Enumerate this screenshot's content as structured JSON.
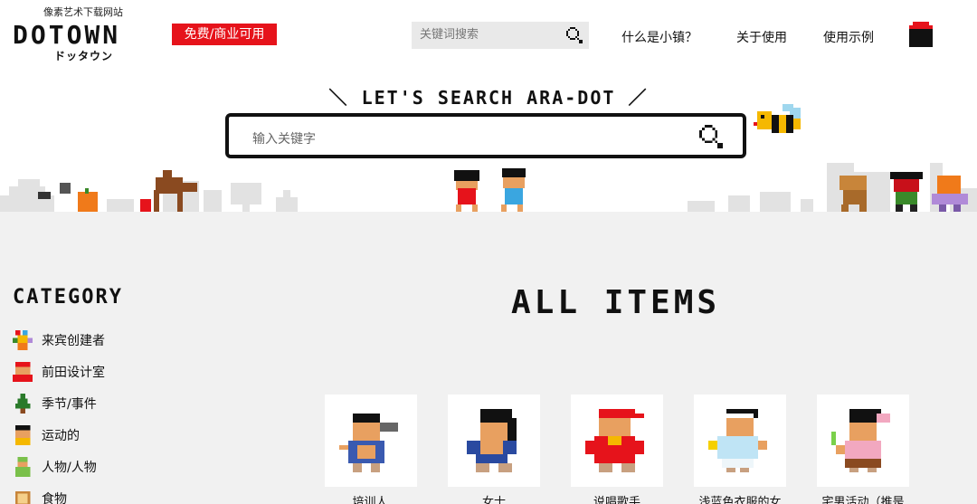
{
  "header": {
    "tagline": "像素艺术下载网站",
    "logo": "DOTOWN",
    "logo_sub": "ドッタウン",
    "badge": "免费/商业可用",
    "search_placeholder": "关键词搜索",
    "nav": [
      "什么是小镇？",
      "关于使用",
      "使用示例"
    ],
    "menu_icon": "menu-icon"
  },
  "hero": {
    "title": "＼ LET'S SEARCH ARA-DOT ／",
    "search_placeholder": "输入关键字"
  },
  "category": {
    "heading": "CATEGORY",
    "items": [
      {
        "label": "来宾创建者",
        "icon": "guest-creator-icon"
      },
      {
        "label": "前田设计室",
        "icon": "maeda-design-icon"
      },
      {
        "label": "季节/事件",
        "icon": "tree-icon"
      },
      {
        "label": "运动的",
        "icon": "sports-icon"
      },
      {
        "label": "人物/人物",
        "icon": "person-icon"
      },
      {
        "label": "食物",
        "icon": "food-icon"
      }
    ]
  },
  "items": {
    "heading": "ALL ITEMS",
    "cards": [
      {
        "label": "培训人"
      },
      {
        "label": "女士"
      },
      {
        "label": "说唱歌手"
      },
      {
        "label": "浅蓝色衣服的女"
      },
      {
        "label": "宅男活动（推是"
      }
    ]
  },
  "colors": {
    "accent_red": "#e6131b",
    "gray_bg": "#f1f1f1",
    "search_bg": "#e9e9e9"
  }
}
